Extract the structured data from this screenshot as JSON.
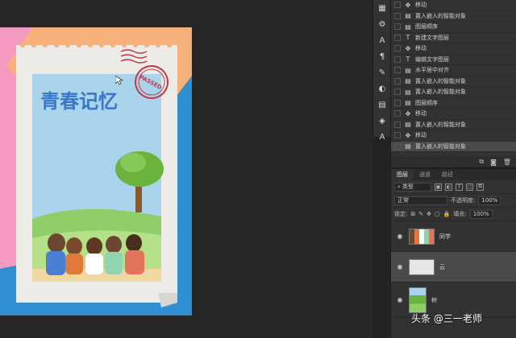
{
  "canvas": {
    "title_text": "青春记忆",
    "stamp_text": "PASSED",
    "colors": {
      "orange": "#f8b07a",
      "blue": "#2f8fd0",
      "pink": "#f49ac1",
      "paper": "#ecebe6",
      "sky": "#a9d4ec",
      "title": "#3a77c8",
      "stamp_red": "#c0394a"
    }
  },
  "history": {
    "items": [
      {
        "icon": "move-icon",
        "label": "移动"
      },
      {
        "icon": "history-step-icon",
        "label": "置入嵌入的智能对象"
      },
      {
        "icon": "history-step-icon",
        "label": "图层顺序"
      },
      {
        "icon": "text-icon",
        "label": "新建文字图层"
      },
      {
        "icon": "move-icon",
        "label": "移动"
      },
      {
        "icon": "text-icon",
        "label": "编辑文字图层"
      },
      {
        "icon": "history-step-icon",
        "label": "水平居中对齐"
      },
      {
        "icon": "history-step-icon",
        "label": "置入嵌入的智能对象"
      },
      {
        "icon": "history-step-icon",
        "label": "置入嵌入的智能对象"
      },
      {
        "icon": "history-step-icon",
        "label": "图层顺序"
      },
      {
        "icon": "move-icon",
        "label": "移动"
      },
      {
        "icon": "history-step-icon",
        "label": "置入嵌入的智能对象"
      },
      {
        "icon": "move-icon",
        "label": "移动"
      },
      {
        "icon": "history-step-icon",
        "label": "置入嵌入的智能对象"
      }
    ]
  },
  "layers_panel": {
    "tabs": [
      "图层",
      "通道",
      "路径"
    ],
    "filter_label": "类型",
    "blend_mode": "正常",
    "opacity_label": "不透明度:",
    "opacity_value": "100%",
    "lock_label": "锁定:",
    "fill_label": "填充:",
    "fill_value": "100%",
    "layers": [
      {
        "name": "同学"
      },
      {
        "name": "云"
      },
      {
        "name": "树"
      }
    ]
  },
  "watermark": "头条 @三一老师"
}
